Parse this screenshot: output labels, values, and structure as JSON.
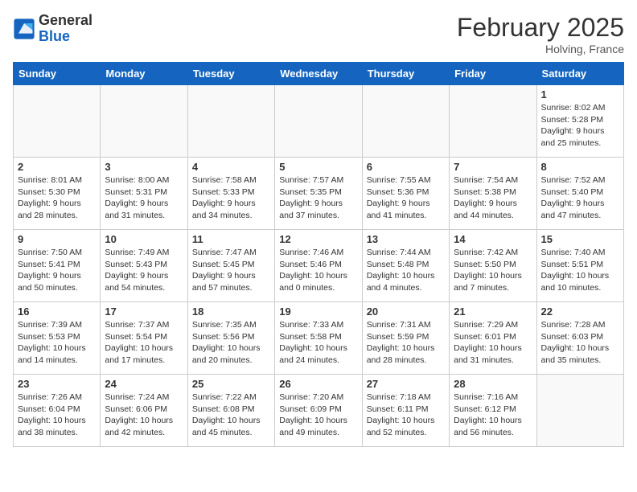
{
  "header": {
    "logo_general": "General",
    "logo_blue": "Blue",
    "month_title": "February 2025",
    "location": "Holving, France"
  },
  "days_of_week": [
    "Sunday",
    "Monday",
    "Tuesday",
    "Wednesday",
    "Thursday",
    "Friday",
    "Saturday"
  ],
  "weeks": [
    [
      {
        "day": "",
        "info": ""
      },
      {
        "day": "",
        "info": ""
      },
      {
        "day": "",
        "info": ""
      },
      {
        "day": "",
        "info": ""
      },
      {
        "day": "",
        "info": ""
      },
      {
        "day": "",
        "info": ""
      },
      {
        "day": "1",
        "info": "Sunrise: 8:02 AM\nSunset: 5:28 PM\nDaylight: 9 hours and 25 minutes."
      }
    ],
    [
      {
        "day": "2",
        "info": "Sunrise: 8:01 AM\nSunset: 5:30 PM\nDaylight: 9 hours and 28 minutes."
      },
      {
        "day": "3",
        "info": "Sunrise: 8:00 AM\nSunset: 5:31 PM\nDaylight: 9 hours and 31 minutes."
      },
      {
        "day": "4",
        "info": "Sunrise: 7:58 AM\nSunset: 5:33 PM\nDaylight: 9 hours and 34 minutes."
      },
      {
        "day": "5",
        "info": "Sunrise: 7:57 AM\nSunset: 5:35 PM\nDaylight: 9 hours and 37 minutes."
      },
      {
        "day": "6",
        "info": "Sunrise: 7:55 AM\nSunset: 5:36 PM\nDaylight: 9 hours and 41 minutes."
      },
      {
        "day": "7",
        "info": "Sunrise: 7:54 AM\nSunset: 5:38 PM\nDaylight: 9 hours and 44 minutes."
      },
      {
        "day": "8",
        "info": "Sunrise: 7:52 AM\nSunset: 5:40 PM\nDaylight: 9 hours and 47 minutes."
      }
    ],
    [
      {
        "day": "9",
        "info": "Sunrise: 7:50 AM\nSunset: 5:41 PM\nDaylight: 9 hours and 50 minutes."
      },
      {
        "day": "10",
        "info": "Sunrise: 7:49 AM\nSunset: 5:43 PM\nDaylight: 9 hours and 54 minutes."
      },
      {
        "day": "11",
        "info": "Sunrise: 7:47 AM\nSunset: 5:45 PM\nDaylight: 9 hours and 57 minutes."
      },
      {
        "day": "12",
        "info": "Sunrise: 7:46 AM\nSunset: 5:46 PM\nDaylight: 10 hours and 0 minutes."
      },
      {
        "day": "13",
        "info": "Sunrise: 7:44 AM\nSunset: 5:48 PM\nDaylight: 10 hours and 4 minutes."
      },
      {
        "day": "14",
        "info": "Sunrise: 7:42 AM\nSunset: 5:50 PM\nDaylight: 10 hours and 7 minutes."
      },
      {
        "day": "15",
        "info": "Sunrise: 7:40 AM\nSunset: 5:51 PM\nDaylight: 10 hours and 10 minutes."
      }
    ],
    [
      {
        "day": "16",
        "info": "Sunrise: 7:39 AM\nSunset: 5:53 PM\nDaylight: 10 hours and 14 minutes."
      },
      {
        "day": "17",
        "info": "Sunrise: 7:37 AM\nSunset: 5:54 PM\nDaylight: 10 hours and 17 minutes."
      },
      {
        "day": "18",
        "info": "Sunrise: 7:35 AM\nSunset: 5:56 PM\nDaylight: 10 hours and 20 minutes."
      },
      {
        "day": "19",
        "info": "Sunrise: 7:33 AM\nSunset: 5:58 PM\nDaylight: 10 hours and 24 minutes."
      },
      {
        "day": "20",
        "info": "Sunrise: 7:31 AM\nSunset: 5:59 PM\nDaylight: 10 hours and 28 minutes."
      },
      {
        "day": "21",
        "info": "Sunrise: 7:29 AM\nSunset: 6:01 PM\nDaylight: 10 hours and 31 minutes."
      },
      {
        "day": "22",
        "info": "Sunrise: 7:28 AM\nSunset: 6:03 PM\nDaylight: 10 hours and 35 minutes."
      }
    ],
    [
      {
        "day": "23",
        "info": "Sunrise: 7:26 AM\nSunset: 6:04 PM\nDaylight: 10 hours and 38 minutes."
      },
      {
        "day": "24",
        "info": "Sunrise: 7:24 AM\nSunset: 6:06 PM\nDaylight: 10 hours and 42 minutes."
      },
      {
        "day": "25",
        "info": "Sunrise: 7:22 AM\nSunset: 6:08 PM\nDaylight: 10 hours and 45 minutes."
      },
      {
        "day": "26",
        "info": "Sunrise: 7:20 AM\nSunset: 6:09 PM\nDaylight: 10 hours and 49 minutes."
      },
      {
        "day": "27",
        "info": "Sunrise: 7:18 AM\nSunset: 6:11 PM\nDaylight: 10 hours and 52 minutes."
      },
      {
        "day": "28",
        "info": "Sunrise: 7:16 AM\nSunset: 6:12 PM\nDaylight: 10 hours and 56 minutes."
      },
      {
        "day": "",
        "info": ""
      }
    ]
  ]
}
